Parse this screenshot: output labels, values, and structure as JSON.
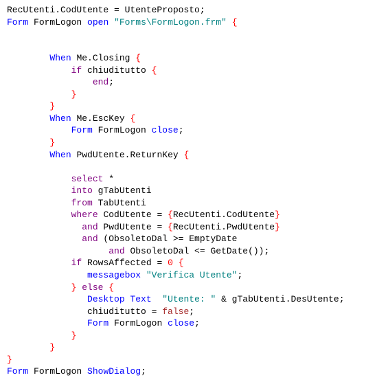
{
  "code": {
    "l1": {
      "a": "RecUtenti.CodUtente = UtenteProposto;"
    },
    "l2": {
      "a": "Form",
      "b": " FormLogon ",
      "c": "open",
      "d": " ",
      "e": "\"Forms\\FormLogon.frm\"",
      "f": " ",
      "g": "{"
    },
    "l3": {
      "a": ""
    },
    "l4": {
      "a": ""
    },
    "l5": {
      "a": "        ",
      "b": "When",
      "c": " Me.Closing ",
      "d": "{"
    },
    "l6": {
      "a": "            ",
      "b": "if",
      "c": " chiuditutto ",
      "d": "{"
    },
    "l7": {
      "a": "                ",
      "b": "end",
      ";": ";"
    },
    "l8": {
      "a": "            ",
      "b": "}"
    },
    "l9": {
      "a": "        ",
      "b": "}"
    },
    "l10": {
      "a": "        ",
      "b": "When",
      "c": " Me.EscKey ",
      "d": "{"
    },
    "l11": {
      "a": "            ",
      "b": "Form",
      "c": " FormLogon ",
      "d": "close",
      "e": ";"
    },
    "l12": {
      "a": "        ",
      "b": "}"
    },
    "l13": {
      "a": "        ",
      "b": "When",
      "c": " PwdUtente.ReturnKey ",
      "d": "{"
    },
    "l14": {
      "a": ""
    },
    "l15": {
      "a": "            ",
      "b": "select",
      "c": " *"
    },
    "l16": {
      "a": "            ",
      "b": "into",
      "c": " gTabUtenti"
    },
    "l17": {
      "a": "            ",
      "b": "from",
      "c": " TabUtenti"
    },
    "l18": {
      "a": "            ",
      "b": "where",
      "c": " CodUtente = ",
      "d": "{",
      "e": "RecUtenti.CodUtente",
      "f": "}"
    },
    "l19": {
      "a": "              ",
      "b": "and",
      "c": " PwdUtente = ",
      "d": "{",
      "e": "RecUtenti.PwdUtente",
      "f": "}"
    },
    "l20": {
      "a": "              ",
      "b": "and",
      "c": " (ObsoletoDal >= EmptyDate"
    },
    "l21": {
      "a": "                   ",
      "b": "and",
      "c": " ObsoletoDal <= GetDate());"
    },
    "l22": {
      "a": "            ",
      "b": "if",
      "c": " RowsAffected = ",
      "d": "0",
      "e": " ",
      "f": "{"
    },
    "l23": {
      "a": "               ",
      "b": "messagebox",
      "c": " ",
      "d": "\"Verifica Utente\"",
      "e": ";"
    },
    "l24": {
      "a": "            ",
      "b": "}",
      "c": " ",
      "d": "else",
      "e": " ",
      "f": "{"
    },
    "l25": {
      "a": "               ",
      "b": "Desktop Text",
      "c": "  ",
      "d": "\"Utente: \"",
      "e": " & gTabUtenti.DesUtente;"
    },
    "l26": {
      "a": "               chiuditutto = ",
      "b": "false",
      "c": ";"
    },
    "l27": {
      "a": "               ",
      "b": "Form",
      "c": " FormLogon ",
      "d": "close",
      "e": ";"
    },
    "l28": {
      "a": "            ",
      "b": "}"
    },
    "l29": {
      "a": "        ",
      "b": "}"
    },
    "l30": {
      "a": "}"
    },
    "l31": {
      "a": "Form",
      "b": " FormLogon ",
      "c": "ShowDialog",
      "d": ";"
    }
  }
}
